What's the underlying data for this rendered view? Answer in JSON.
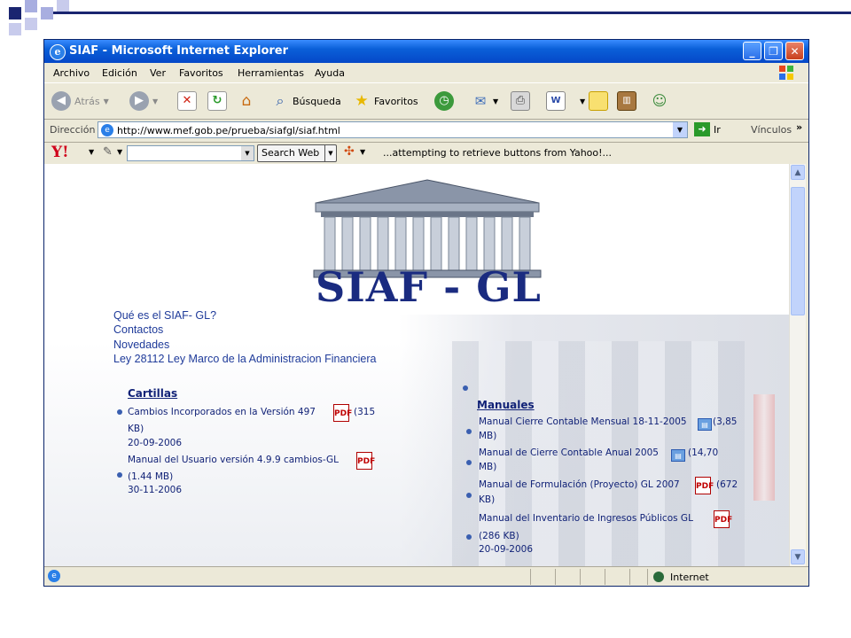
{
  "colors": {
    "titlebar": "#0a5fd8",
    "link": "#1f3b9a",
    "siaf_logo": "#1a2b80"
  },
  "window": {
    "title": "SIAF - Microsoft Internet Explorer",
    "controls": {
      "minimize": "_",
      "maximize": "❐",
      "close": "✕"
    }
  },
  "menu": [
    "Archivo",
    "Edición",
    "Ver",
    "Favoritos",
    "Herramientas",
    "Ayuda"
  ],
  "toolbar": {
    "back": "Atrás",
    "search": "Búsqueda",
    "favorites": "Favoritos",
    "icons": [
      "back-icon",
      "forward-icon",
      "stop-icon",
      "refresh-icon",
      "home-icon",
      "search-icon",
      "favorites-star-icon",
      "history-icon",
      "mail-icon",
      "print-icon",
      "word-icon",
      "folder-icon",
      "research-icon",
      "messenger-icon"
    ]
  },
  "address": {
    "label": "Dirección",
    "url": "http://www.mef.gob.pe/prueba/siafgl/siaf.html",
    "go": "Ir",
    "links": "Vínculos",
    "more": "»"
  },
  "yahoo": {
    "logo": "Y!",
    "search_button": "Search Web",
    "status": "...attempting to retrieve buttons from Yahoo!..."
  },
  "page": {
    "logo_text": "SIAF - GL",
    "nav_links": [
      "Qué es el SIAF- GL?",
      "Contactos",
      "Novedades",
      "Ley 28112 Ley Marco de la Administracion Financiera"
    ],
    "cartillas": {
      "heading": "Cartillas",
      "items": [
        {
          "title": "Cambios Incorporados en la Versión 497",
          "size_a": "(315",
          "size_b": "KB)",
          "date": "20-09-2006"
        },
        {
          "title": "Manual del Usuario versión 4.9.9 cambios-GL",
          "size_a": "",
          "size_b": "(1.44 MB)",
          "date": "30-11-2006"
        }
      ]
    },
    "manuales": {
      "heading": "Manuales",
      "items": [
        {
          "title": "Manual Cierre Contable Mensual 18-11-2005",
          "size_a": "(3,85",
          "size_b": "MB)"
        },
        {
          "title": "Manual de Cierre Contable Anual 2005",
          "size_a": "(14,70",
          "size_b": "MB)"
        },
        {
          "title": "Manual de Formulación (Proyecto) GL 2007",
          "size_a": "(672",
          "size_b": "KB)"
        },
        {
          "title": "Manual del Inventario de Ingresos Públicos GL",
          "size_a": "",
          "size_b": "(286 KB)",
          "date": "20-09-2006"
        }
      ]
    }
  },
  "status": {
    "zone": "Internet"
  }
}
